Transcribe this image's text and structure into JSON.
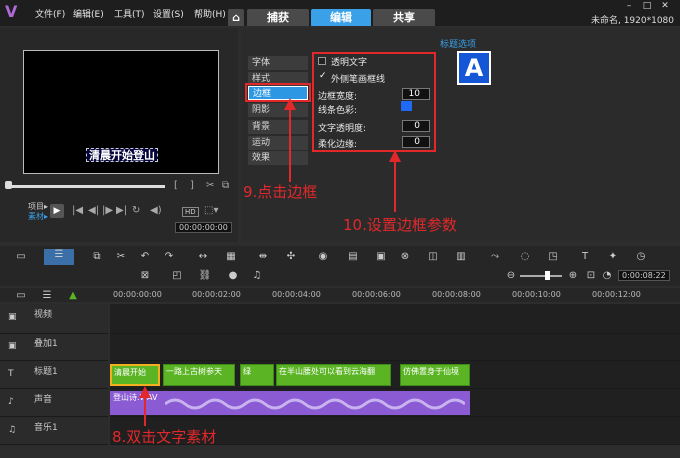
{
  "menu": {
    "file": "文件(F)",
    "edit": "编辑(E)",
    "tools": "工具(T)",
    "settings": "设置(S)",
    "help": "帮助(H)"
  },
  "tabs": {
    "capture": "捕获",
    "edit": "编辑",
    "share": "共享"
  },
  "project_info": "未命名, 1920*1080",
  "preview": {
    "title_text": "清晨开始登山",
    "project_label": "项目▸",
    "clip_label": "素材▸",
    "timecode": "00:00:00:00",
    "hd_label": "HD"
  },
  "options": {
    "header": "标题选项",
    "side_tabs": [
      "字体",
      "样式",
      "边框",
      "阴影",
      "背景",
      "运动",
      "效果"
    ],
    "transparent_text": "透明文字",
    "outer_stroke": "外侧笔画框线",
    "border_width_label": "边框宽度:",
    "border_width": "10",
    "line_color_label": "线条色彩:",
    "text_transparency_label": "文字透明度:",
    "text_transparency": "0",
    "soften_edge_label": "柔化边缘:",
    "soften_edge": "0",
    "preview_letter": "A"
  },
  "annotations": {
    "step9": "9.点击边框",
    "step10": "10.设置边框参数",
    "step8": "8.双击文字素材"
  },
  "toolbar": {
    "timecode": "0:00:08:22"
  },
  "ruler": [
    "00:00:00:00",
    "00:00:02:00",
    "00:00:04:00",
    "00:00:06:00",
    "00:00:08:00",
    "00:00:10:00",
    "00:00:12:00"
  ],
  "tracks": [
    "视频",
    "叠加1",
    "标题1",
    "声音",
    "音乐1"
  ],
  "clips": [
    "清晨开始",
    "一路上古树参天",
    "绿",
    "在半山腰处可以看到云海翻",
    "仿佛置身于仙境"
  ],
  "audio_clip": "登山诗.WAV",
  "colors": {
    "accent": "#3aa0e8",
    "annotation": "#e3282b",
    "title_clip": "#5bb424",
    "audio_clip": "#8b5bd4"
  }
}
